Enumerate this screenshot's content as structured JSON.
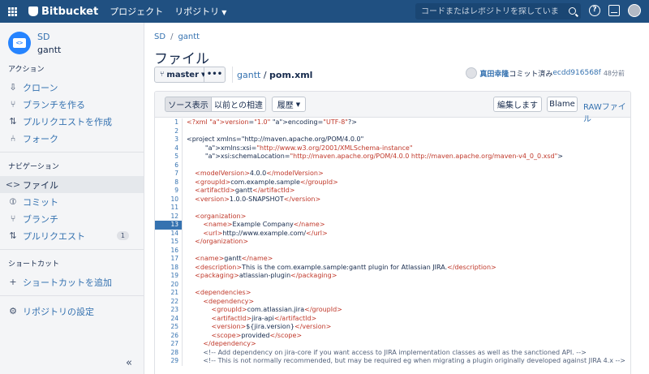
{
  "topbar": {
    "app_name": "Bitbucket",
    "nav": [
      "プロジェクト",
      "リポジトリ"
    ],
    "search_placeholder": "コードまたはレポジトリを探しています..."
  },
  "sidebar": {
    "project": "SD",
    "repo": "gantt",
    "sections": [
      {
        "heading": "アクション",
        "items": [
          {
            "label": "クローン",
            "icon": "clone-icon"
          },
          {
            "label": "ブランチを作る",
            "icon": "branch-icon"
          },
          {
            "label": "プルリクエストを作成",
            "icon": "pull-request-icon"
          },
          {
            "label": "フォーク",
            "icon": "fork-icon"
          }
        ]
      },
      {
        "heading": "ナビゲーション",
        "items": [
          {
            "label": "ファイル",
            "icon": "code-icon",
            "active": true
          },
          {
            "label": "コミット",
            "icon": "commit-icon"
          },
          {
            "label": "ブランチ",
            "icon": "branch-icon"
          },
          {
            "label": "プルリクエスト",
            "icon": "pull-request-icon",
            "badge": "1"
          }
        ]
      },
      {
        "heading": "ショートカット",
        "items": [
          {
            "label": "ショートカットを追加",
            "icon": "plus-icon"
          }
        ]
      }
    ],
    "settings_label": "リポジトリの設定"
  },
  "main": {
    "breadcrumb": [
      "SD",
      "gantt"
    ],
    "title": "ファイル",
    "branch": "master",
    "more": "•••",
    "path_repo": "gantt",
    "path_sep": " / ",
    "path_file": "pom.xml",
    "commit": {
      "author": "真田幸隆",
      "action": "コミット済み",
      "hash": "ecdd916568f",
      "time": "48分前"
    },
    "toolbar": {
      "source": "ソース表示",
      "diff": "以前との相違",
      "history": "履歴",
      "edit": "編集します",
      "blame": "Blame",
      "raw": "RAWファイル"
    }
  },
  "code": {
    "highlight_line": 13,
    "lines": [
      "<?xml version=\"1.0\" encoding=\"UTF-8\"?>",
      "",
      "<project xmlns=\"http://maven.apache.org/POM/4.0.0\"",
      "         xmlns:xsi=\"http://www.w3.org/2001/XMLSchema-instance\"",
      "         xsi:schemaLocation=\"http://maven.apache.org/POM/4.0.0 http://maven.apache.org/maven-v4_0_0.xsd\">",
      "",
      "    <modelVersion>4.0.0</modelVersion>",
      "    <groupId>com.example.sample</groupId>",
      "    <artifactId>gantt</artifactId>",
      "    <version>1.0.0-SNAPSHOT</version>",
      "",
      "    <organization>",
      "        <name>Example Company</name>",
      "        <url>http://www.example.com/</url>",
      "    </organization>",
      "",
      "    <name>gantt</name>",
      "    <description>This is the com.example.sample:gantt plugin for Atlassian JIRA.</description>",
      "    <packaging>atlassian-plugin</packaging>",
      "",
      "    <dependencies>",
      "        <dependency>",
      "            <groupId>com.atlassian.jira</groupId>",
      "            <artifactId>jira-api</artifactId>",
      "            <version>${jira.version}</version>",
      "            <scope>provided</scope>",
      "        </dependency>",
      "        <!-- Add dependency on jira-core if you want access to JIRA implementation classes as well as the sanctioned API. -->",
      "        <!-- This is not normally recommended, but may be required eg when migrating a plugin originally developed against JIRA 4.x -->"
    ]
  },
  "colors": {
    "header": "#205081",
    "link": "#3572b0",
    "tag": "#c0392b"
  }
}
